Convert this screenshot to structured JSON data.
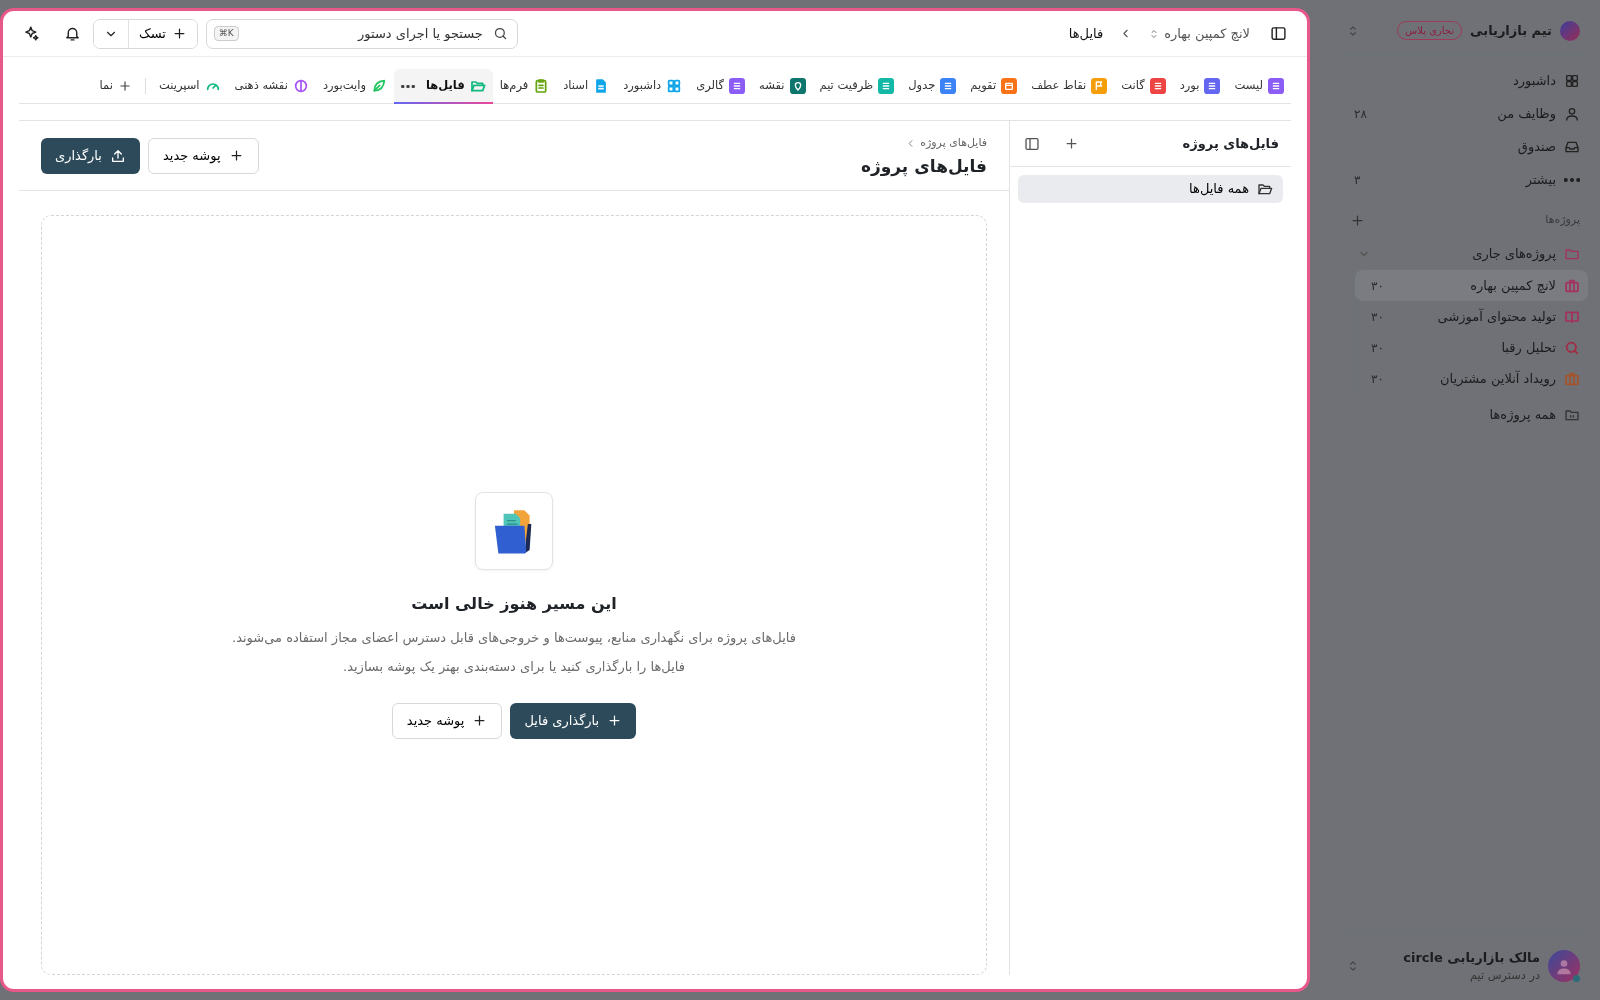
{
  "sidebar": {
    "workspace": {
      "name": "تیم بازاریابی",
      "badge": "تجاری پلاس"
    },
    "nav": [
      {
        "label": "داشبورد"
      },
      {
        "label": "وظایف من",
        "count": "۲۸"
      },
      {
        "label": "صندوق"
      },
      {
        "label": "بیشتر",
        "count": "۳"
      }
    ],
    "projects_heading": "پروژه‌ها",
    "folder": {
      "label": "پروژه‌های جاری",
      "expanded": true,
      "children": [
        {
          "label": "لانچ کمپین بهاره",
          "count": "۳۰",
          "selected": true,
          "color": "#a3315f"
        },
        {
          "label": "تولید محتوای آموزشی",
          "count": "۳۰",
          "selected": false,
          "color": "#a3315f"
        },
        {
          "label": "تحلیل رقبا",
          "count": "۳۰",
          "selected": false,
          "color": "#a32a45"
        },
        {
          "label": "رویداد آنلاین مشتریان",
          "count": "۳۰",
          "selected": false,
          "color": "#a5532a"
        }
      ]
    },
    "all_projects": "همه پروژه‌ها",
    "user": {
      "name": "مالک بازاریابی circle",
      "status": "در دسترس تیم"
    }
  },
  "topbar": {
    "breadcrumb": [
      "لانچ کمپین بهاره",
      "فایل‌ها"
    ],
    "search": {
      "placeholder": "جستجو یا اجرای دستور",
      "shortcut": "⌘K"
    },
    "task_button": "تسک"
  },
  "tabs": [
    {
      "label": "لیست",
      "kind": "filled",
      "color": "#8b5cf6",
      "selected": false
    },
    {
      "label": "بورد",
      "kind": "filled",
      "color": "#6366f1",
      "selected": false
    },
    {
      "label": "گانت",
      "kind": "filled",
      "color": "#ef4444",
      "selected": false
    },
    {
      "label": "نقاط عطف",
      "kind": "filled",
      "color": "#f59e0b",
      "selected": false
    },
    {
      "label": "تقویم",
      "kind": "filled",
      "color": "#f97316",
      "selected": false
    },
    {
      "label": "جدول",
      "kind": "filled",
      "color": "#3b82f6",
      "selected": false
    },
    {
      "label": "ظرفیت تیم",
      "kind": "filled",
      "color": "#14b8a6",
      "selected": false
    },
    {
      "label": "نقشه",
      "kind": "filled",
      "color": "#0f766e",
      "selected": false
    },
    {
      "label": "گالری",
      "kind": "filled",
      "color": "#8b5cf6",
      "selected": false
    },
    {
      "label": "داشبورد",
      "kind": "outline",
      "color": "#0ea5e9",
      "selected": false
    },
    {
      "label": "اسناد",
      "kind": "outline",
      "color": "#0ea5e9",
      "selected": false
    },
    {
      "label": "فرم‌ها",
      "kind": "outline",
      "color": "#65a30d",
      "selected": false
    },
    {
      "label": "فایل‌ها",
      "kind": "outline",
      "color": "#10b981",
      "selected": true
    },
    {
      "label": "وایت‌بورد",
      "kind": "outline",
      "color": "#22c55e",
      "selected": false
    },
    {
      "label": "نقشه ذهنی",
      "kind": "outline",
      "color": "#a855f7",
      "selected": false
    },
    {
      "label": "اسپرینت",
      "kind": "outline",
      "color": "#10b981",
      "selected": false
    }
  ],
  "add_view": "نما",
  "files_panel": {
    "title": "فایل‌های پروژه",
    "items": [
      {
        "label": "همه فایل‌ها",
        "selected": true
      }
    ]
  },
  "content": {
    "breadcrumb": "فایل‌های پروژه",
    "title": "فایل‌های پروژه",
    "new_folder": "پوشه جدید",
    "upload": "بارگذاری"
  },
  "empty_state": {
    "title": "این مسیر هنوز خالی است",
    "lines": [
      "فایل‌های پروژه برای نگهداری منابع، پیوست‌ها و خروجی‌های قابل دسترس اعضای مجاز استفاده می‌شوند.",
      "فایل‌ها را بارگذاری کنید یا برای دسته‌بندی بهتر یک پوشه بسازید."
    ],
    "new_folder": "پوشه جدید",
    "upload": "بارگذاری فایل"
  }
}
